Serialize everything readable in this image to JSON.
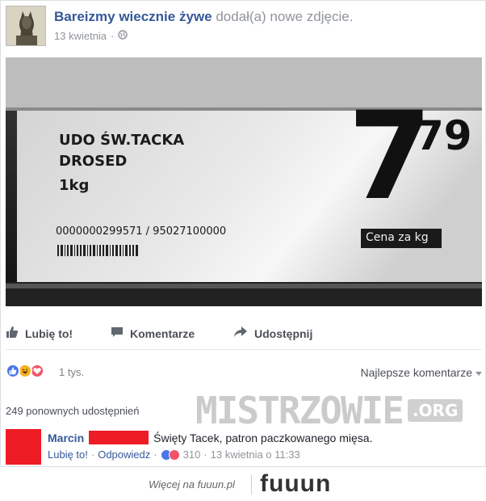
{
  "post": {
    "page_name": "Bareizmy wiecznie żywe",
    "action_text": "dodał(a) nowe zdjęcie.",
    "date": "13 kwietnia",
    "date_separator": "·",
    "privacy_icon": "globe-icon"
  },
  "photo": {
    "product_line1": "UDO ŚW.TACKA",
    "product_line2": "DROSED",
    "product_weight": "1kg",
    "barcode_text": "0000000299571 / 95027100000",
    "price_main": "7",
    "price_cents": "79",
    "price_label": "Cena za kg"
  },
  "actions": {
    "like": "Lubię to!",
    "comment": "Komentarze",
    "share": "Udostępnij"
  },
  "reactions": {
    "count": "1 tys.",
    "icons": [
      "like-icon",
      "haha-icon",
      "love-icon"
    ],
    "sort_label": "Najlepsze komentarze"
  },
  "shares": {
    "text": "249 ponownych udostępnień"
  },
  "watermark": {
    "text": "MISTRZOWIE",
    "badge": ".ORG"
  },
  "comment": {
    "author": "Marcin",
    "text": "Święty Tacek, patron paczkowanego mięsa.",
    "like": "Lubię to!",
    "sep1": "·",
    "reply": "Odpowiedz",
    "sep2": "·",
    "reaction_count": "310",
    "sep3": "·",
    "timestamp": "13 kwietnia o 11:33"
  },
  "footer": {
    "text": "Więcej na fuuun.pl",
    "logo": "fuuun"
  },
  "colors": {
    "link": "#365899",
    "muted": "#90949c",
    "redaction": "#ee1c25",
    "like_blue": "#4a76e8",
    "love_red": "#f25268",
    "haha_yellow": "#f7b125"
  }
}
